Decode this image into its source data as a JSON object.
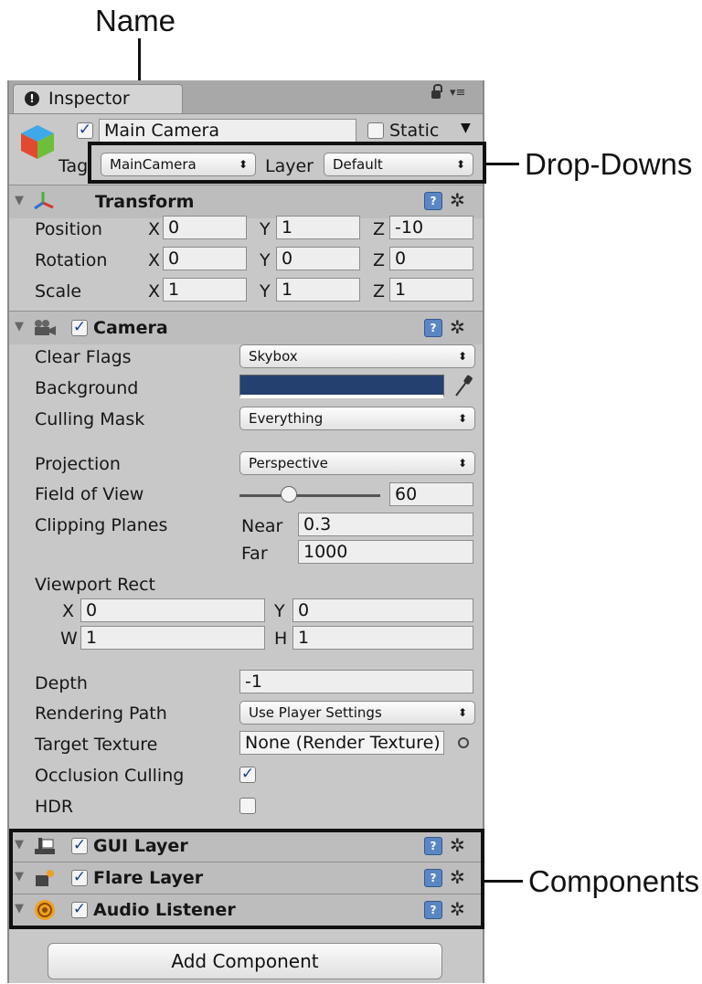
{
  "annotations": {
    "name": "Name",
    "dropdowns": "Drop-Downs",
    "components": "Components"
  },
  "inspector": {
    "tab_label": "Inspector",
    "tab_info_glyph": "!",
    "object": {
      "enabled": true,
      "name": "Main Camera",
      "static_label": "Static",
      "static_checked": false
    },
    "tag_label": "Tag",
    "tag_value": "MainCamera",
    "layer_label": "Layer",
    "layer_value": "Default"
  },
  "transform": {
    "title": "Transform",
    "axis": {
      "x": "X",
      "y": "Y",
      "z": "Z"
    },
    "rows": [
      {
        "label": "Position",
        "x": "0",
        "y": "1",
        "z": "-10"
      },
      {
        "label": "Rotation",
        "x": "0",
        "y": "0",
        "z": "0"
      },
      {
        "label": "Scale",
        "x": "1",
        "y": "1",
        "z": "1"
      }
    ]
  },
  "camera": {
    "title": "Camera",
    "enabled": true,
    "clear_flags_label": "Clear Flags",
    "clear_flags": "Skybox",
    "background_label": "Background",
    "background_color": "#24406f",
    "culling_mask_label": "Culling Mask",
    "culling_mask": "Everything",
    "projection_label": "Projection",
    "projection": "Perspective",
    "fov_label": "Field of View",
    "fov": "60",
    "fov_slider_fraction": 0.35,
    "clipping_label": "Clipping Planes",
    "near_label": "Near",
    "near": "0.3",
    "far_label": "Far",
    "far": "1000",
    "viewport_label": "Viewport Rect",
    "vp_x_label": "X",
    "vp_x": "0",
    "vp_y_label": "Y",
    "vp_y": "0",
    "vp_w_label": "W",
    "vp_w": "1",
    "vp_h_label": "H",
    "vp_h": "1",
    "depth_label": "Depth",
    "depth": "-1",
    "rendering_path_label": "Rendering Path",
    "rendering_path": "Use Player Settings",
    "target_texture_label": "Target Texture",
    "target_texture": "None (Render Texture)",
    "occlusion_label": "Occlusion Culling",
    "occlusion": true,
    "hdr_label": "HDR",
    "hdr": false
  },
  "components": [
    {
      "title": "GUI Layer",
      "icon": "gui-layer-icon",
      "enabled": true
    },
    {
      "title": "Flare Layer",
      "icon": "flare-layer-icon",
      "enabled": true
    },
    {
      "title": "Audio Listener",
      "icon": "audio-listener-icon",
      "enabled": true
    }
  ],
  "add_component_label": "Add Component",
  "glyphs": {
    "check": "✓",
    "updown": "⬍",
    "collapse": "▼",
    "gear": "✲",
    "help": "?",
    "lock": "🔒",
    "menu": "▾≡"
  }
}
